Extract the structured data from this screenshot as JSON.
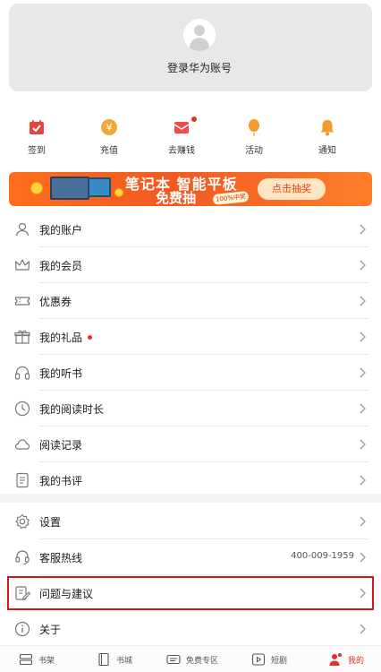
{
  "account": {
    "login_label": "登录华为账号"
  },
  "quick_actions": [
    {
      "label": "签到",
      "icon": "calendar-check-icon",
      "color": "#e8433c"
    },
    {
      "label": "充值",
      "icon": "yen-coin-icon",
      "color": "#f4a636"
    },
    {
      "label": "去赚钱",
      "icon": "envelope-icon",
      "color": "#ef4b48",
      "badge_dot": true
    },
    {
      "label": "活动",
      "icon": "balloon-icon",
      "color": "#f59a2c"
    },
    {
      "label": "通知",
      "icon": "bell-icon",
      "color": "#f59a2c"
    }
  ],
  "banner": {
    "line1": "笔记本 智能平板",
    "line2": "免费抽",
    "badge": "100%中奖",
    "cta": "点击抽奖"
  },
  "menu": [
    {
      "label": "我的账户",
      "icon": "person-icon"
    },
    {
      "label": "我的会员",
      "icon": "crown-icon"
    },
    {
      "label": "优惠券",
      "icon": "ticket-icon"
    },
    {
      "label": "我的礼品",
      "icon": "gift-icon",
      "dot": true
    },
    {
      "label": "我的听书",
      "icon": "headphones-icon"
    },
    {
      "label": "我的阅读时长",
      "icon": "clock-icon"
    },
    {
      "label": "阅读记录",
      "icon": "cloud-icon"
    },
    {
      "label": "我的书评",
      "icon": "comment-doc-icon"
    }
  ],
  "settings_menu": [
    {
      "label": "设置",
      "icon": "gear-icon"
    },
    {
      "label": "客服热线",
      "icon": "headset-icon",
      "value": "400-009-1959"
    },
    {
      "label": "问题与建议",
      "icon": "edit-icon",
      "highlighted": true
    },
    {
      "label": "关于",
      "icon": "info-icon"
    }
  ],
  "bottom_nav": [
    {
      "label": "书架",
      "icon": "bookshelf-icon"
    },
    {
      "label": "书城",
      "icon": "book-icon"
    },
    {
      "label": "免费专区",
      "icon": "free-badge-icon"
    },
    {
      "label": "短剧",
      "icon": "play-icon"
    },
    {
      "label": "我的",
      "icon": "user-icon",
      "active": true
    }
  ],
  "colors": {
    "accent": "#e0312b",
    "highlight_border": "#d9141c",
    "banner_orange": "#f15a22"
  }
}
